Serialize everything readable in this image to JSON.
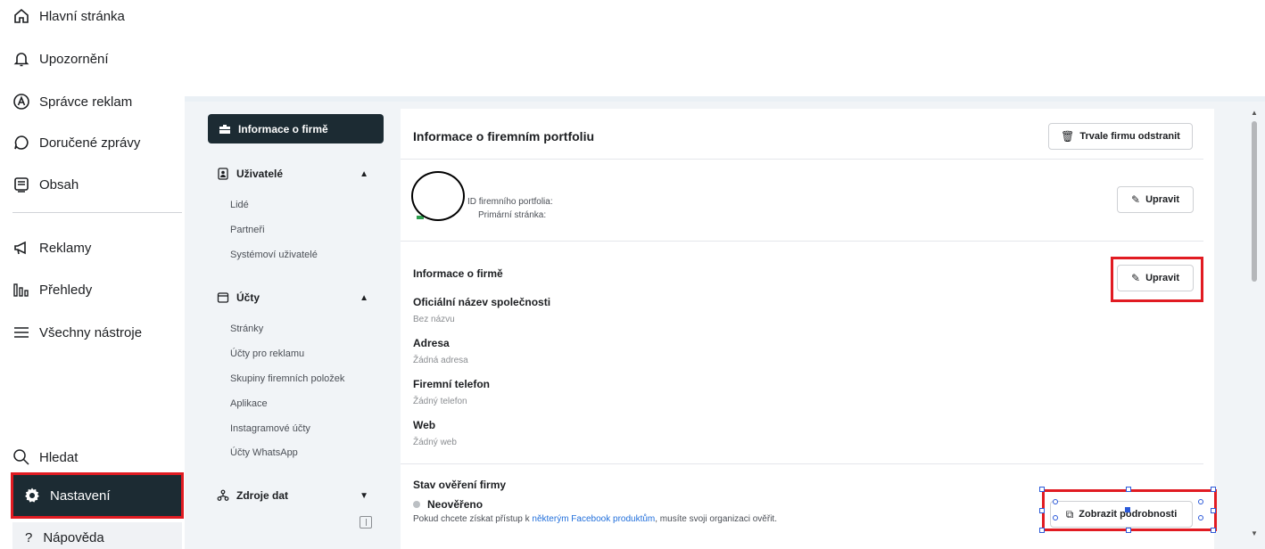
{
  "nav": {
    "home": "Hlavní stránka",
    "notifications": "Upozornění",
    "ads_manager": "Správce reklam",
    "inbox": "Doručené zprávy",
    "content": "Obsah",
    "ads": "Reklamy",
    "insights": "Přehledy",
    "all_tools": "Všechny nástroje",
    "search": "Hledat",
    "settings": "Nastavení",
    "help": "Nápověda"
  },
  "settings_nav": {
    "active": "Informace o firmě",
    "users_group": "Uživatelé",
    "users_items": [
      "Lidé",
      "Partneři",
      "Systémoví uživatelé"
    ],
    "accounts_group": "Účty",
    "accounts_items": [
      "Stránky",
      "Účty pro reklamu",
      "Skupiny firemních položek",
      "Aplikace",
      "Instagramové účty",
      "Účty WhatsApp"
    ],
    "data_sources_group": "Zdroje dat"
  },
  "content": {
    "title": "Informace o firemním portfoliu",
    "delete_button": "Trvale firmu odstranit",
    "portfolio_id_label": "ID firemního portfolia:",
    "primary_page_label": "Primární stránka:",
    "edit_button": "Upravit",
    "business_info_title": "Informace o firmě",
    "fields": [
      {
        "label": "Oficiální název společnosti",
        "value": "Bez názvu"
      },
      {
        "label": "Adresa",
        "value": "Žádná adresa"
      },
      {
        "label": "Firemní telefon",
        "value": "Žádný telefon"
      },
      {
        "label": "Web",
        "value": "Žádný web"
      }
    ],
    "verification_title": "Stav ověření firmy",
    "verification_status": "Neověřeno",
    "verification_desc_pre": "Pokud chcete získat přístup k ",
    "verification_desc_link": "některým Facebook produktům",
    "verification_desc_post": ", musíte svoji organizaci ověřit.",
    "details_button": "Zobrazit podrobnosti"
  },
  "colors": {
    "highlight": "#e11b22",
    "dark_nav": "#1c2b33",
    "link": "#216fdb"
  }
}
